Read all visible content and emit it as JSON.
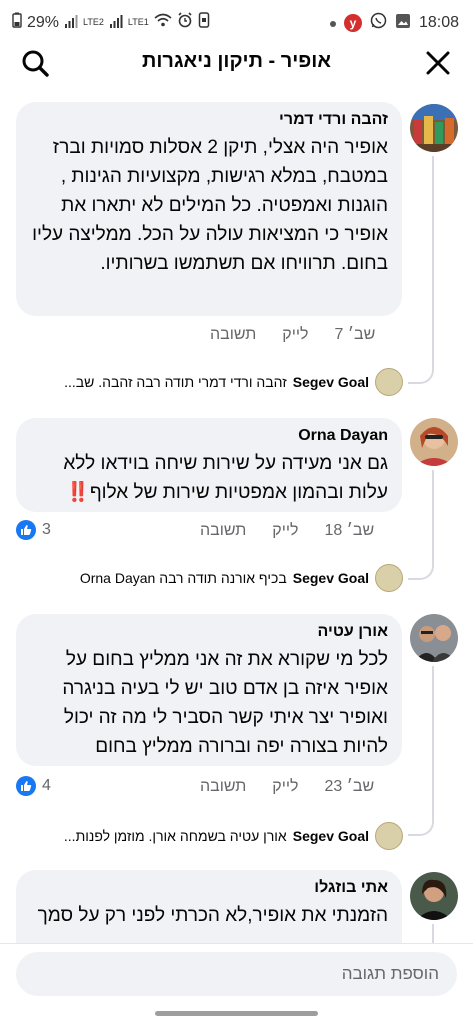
{
  "status_bar": {
    "battery": "29%",
    "sim1": "LTE2",
    "sim2": "LTE1",
    "notif_badge": "y",
    "time": "18:08"
  },
  "header": {
    "title": "אופיר - תיקון ניאגרות"
  },
  "comments": [
    {
      "author": "זהבה ורדי דמרי",
      "text": "אופיר היה אצלי, תיקן 2 אסלות סמויות וברז במטבח, במלא רגישות, מקצועיות הגינות , הוגנות ואמפטיה. כל המילים לא יתארו את אופיר כי המציאות עולה על הכל. ממליצה עליו בחום. תרוויחו אם תשתמשו בשרותיו.",
      "date": "7 שב׳",
      "like_label": "לייק",
      "reply_label": "תשובה",
      "reaction_count": "",
      "reply": {
        "author": "Segev Goal",
        "text": "זהבה ורדי דמרי תודה רבה זהבה. שב..."
      }
    },
    {
      "author": "Orna Dayan",
      "text": "גם אני מעידה על שירות שיחה בוידאו ללא עלות ובהמון אמפטיות שירות של אלוף‼️",
      "date": "18 שב׳",
      "like_label": "לייק",
      "reply_label": "תשובה",
      "reaction_count": "3",
      "reply": {
        "author": "Segev Goal",
        "text": "בכיף אורנה תודה רבה Orna Dayan"
      }
    },
    {
      "author": "אורן עטיה",
      "text": "לכל מי שקורא את זה אני ממליץ בחום על אופיר איזה בן אדם טוב יש לי בעיה בניגרה ואופיר יצר איתי קשר הסביר לי מה זה יכול להיות בצורה יפה וברורה ממליץ בחום",
      "date": "23 שב׳",
      "like_label": "לייק",
      "reply_label": "תשובה",
      "reaction_count": "4",
      "reply": {
        "author": "Segev Goal",
        "text": "אורן עטיה בשמחה אורן. מוזמן לפנות..."
      }
    },
    {
      "author": "אתי בוזגלו",
      "text": "הזמנתי את אופיר,לא הכרתי לפני רק על סמך"
    }
  ],
  "footer": {
    "input_placeholder": "הוספת תגובה"
  },
  "colors": {
    "bubble": "#f0f2f5",
    "accent": "#1877f2",
    "meta_text": "#65676b",
    "alert": "#d32f2f"
  }
}
